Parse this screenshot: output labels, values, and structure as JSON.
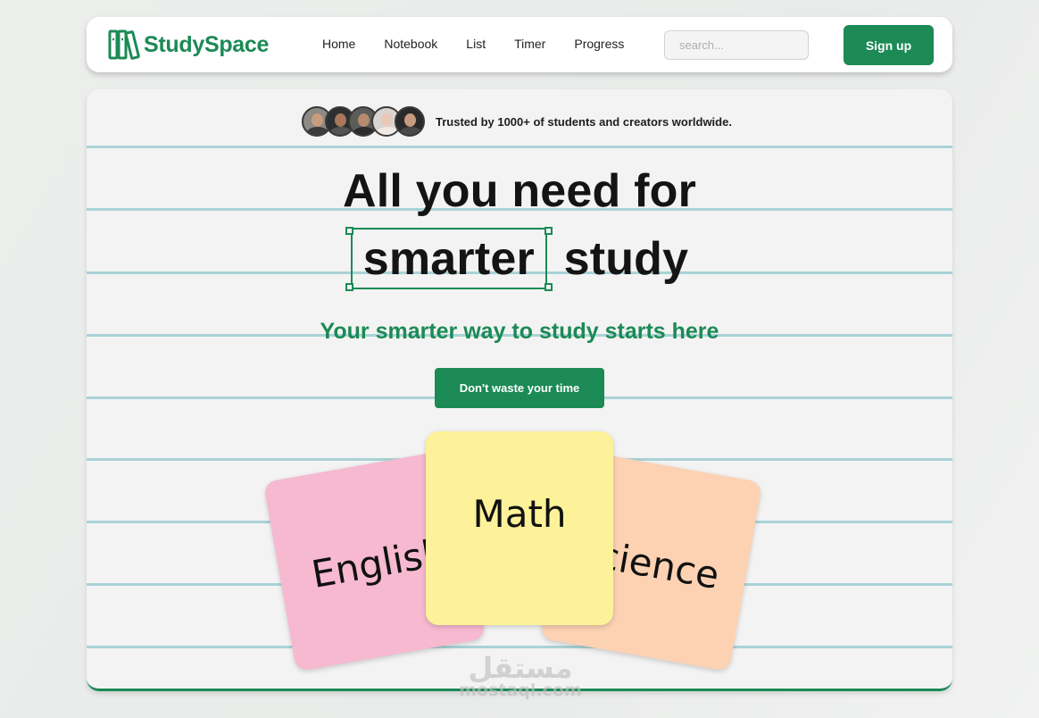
{
  "brand": {
    "name": "StudySpace",
    "color": "#1b8a55",
    "logo_icon": "books-icon"
  },
  "nav": {
    "links": [
      "Home",
      "Notebook",
      "List",
      "Timer",
      "Progress"
    ],
    "search_placeholder": "search...",
    "signup_label": "Sign up"
  },
  "hero": {
    "trusted_text": "Trusted by 1000+ of students and creators worldwide.",
    "avatar_count": 5,
    "headline_line1": "All you need for",
    "headline_highlight": "smarter",
    "headline_rest": "study",
    "subheadline": "Your smarter way to study starts here",
    "cta_label": "Don't waste your time"
  },
  "cards": [
    {
      "label": "English",
      "color": "#f6b9d0"
    },
    {
      "label": "Math",
      "color": "#fdf199"
    },
    {
      "label": "Science",
      "color": "#fcd2b3"
    }
  ],
  "watermark": {
    "arabic": "مستقل",
    "latin": "mostaql.com"
  },
  "colors": {
    "accent": "#1b8a55",
    "rule_line": "#a9d3d6",
    "panel": "#f3f3f3"
  }
}
